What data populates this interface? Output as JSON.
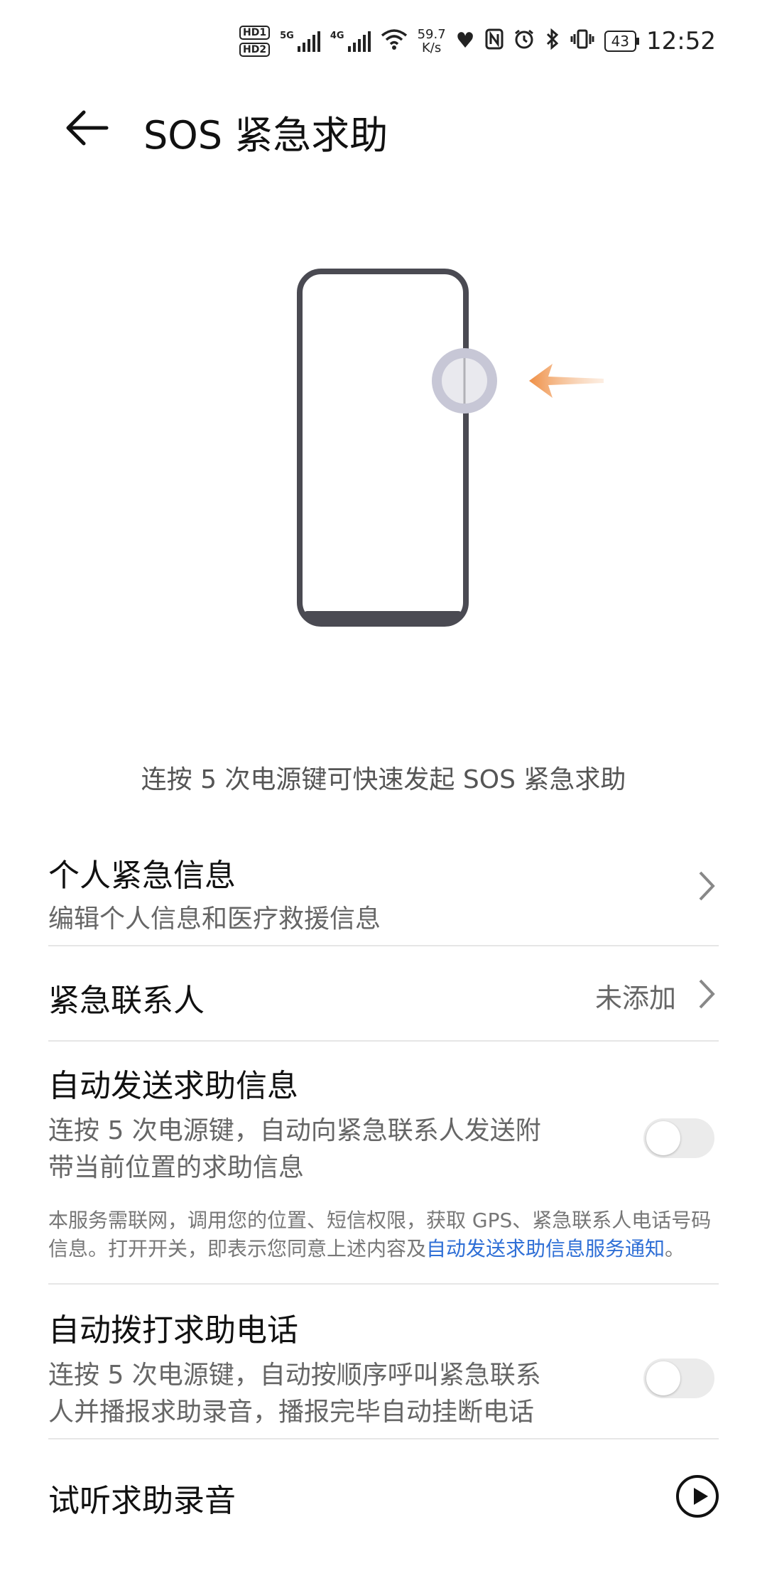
{
  "status_bar": {
    "hd1": "HD1",
    "hd2": "HD2",
    "sig1_label": "5G",
    "sig2_label": "4G",
    "speed_value": "59.7",
    "speed_unit": "K/s",
    "battery": "43",
    "time": "12:52"
  },
  "header": {
    "title": "SOS 紧急求助"
  },
  "hint": "连按 5 次电源键可快速发起 SOS 紧急求助",
  "personal_info": {
    "title": "个人紧急信息",
    "subtitle": "编辑个人信息和医疗救援信息"
  },
  "contacts": {
    "title": "紧急联系人",
    "value": "未添加"
  },
  "auto_message": {
    "title": "自动发送求助信息",
    "subtitle_line1": "连按 5 次电源键，自动向紧急联系人发送附",
    "subtitle_line2": "带当前位置的求助信息",
    "notice_line1": "本服务需联网，调用您的位置、短信权限，获取 GPS、紧急联系人电话号码",
    "notice_line2": "信息。打开开关，即表示您同意上述内容及",
    "notice_link": "自动发送求助信息服务通知",
    "notice_end": "。",
    "enabled": false
  },
  "auto_call": {
    "title": "自动拨打求助电话",
    "subtitle_line1": "连按 5 次电源键，自动按顺序呼叫紧急联系",
    "subtitle_line2": "人并播报求助录音，播报完毕自动挂断电话",
    "enabled": false
  },
  "preview": {
    "title": "试听求助录音"
  },
  "colors": {
    "accent": "#2f6fd6",
    "arrow": "#f0a060",
    "phone_outline": "#4a4a52",
    "button_ring": "#c7c7d6"
  }
}
